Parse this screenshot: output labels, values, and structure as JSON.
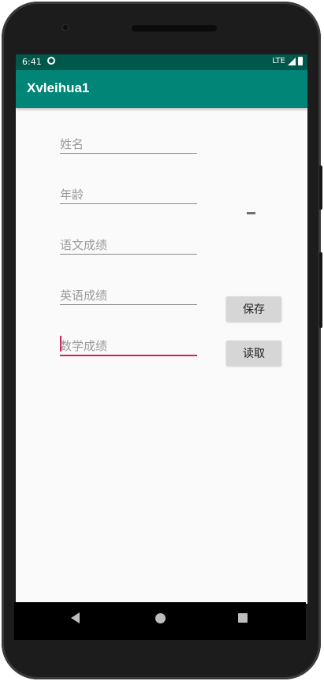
{
  "status_bar": {
    "time": "6:41",
    "network": "LTE"
  },
  "app_bar": {
    "title": "Xvleihua1"
  },
  "form": {
    "name_hint": "姓名",
    "age_hint": "年龄",
    "chinese_hint": "语文成绩",
    "english_hint": "英语成绩",
    "math_hint": "数学成绩"
  },
  "display_text": "-",
  "buttons": {
    "save": "保存",
    "read": "读取"
  },
  "colors": {
    "primary": "#008577",
    "primary_dark": "#00574b",
    "accent": "#d81b60"
  },
  "icons": {
    "sync": "sync-icon",
    "signal": "signal-icon",
    "battery": "battery-icon",
    "back": "nav-back-icon",
    "home": "nav-home-icon",
    "recents": "nav-recents-icon"
  }
}
